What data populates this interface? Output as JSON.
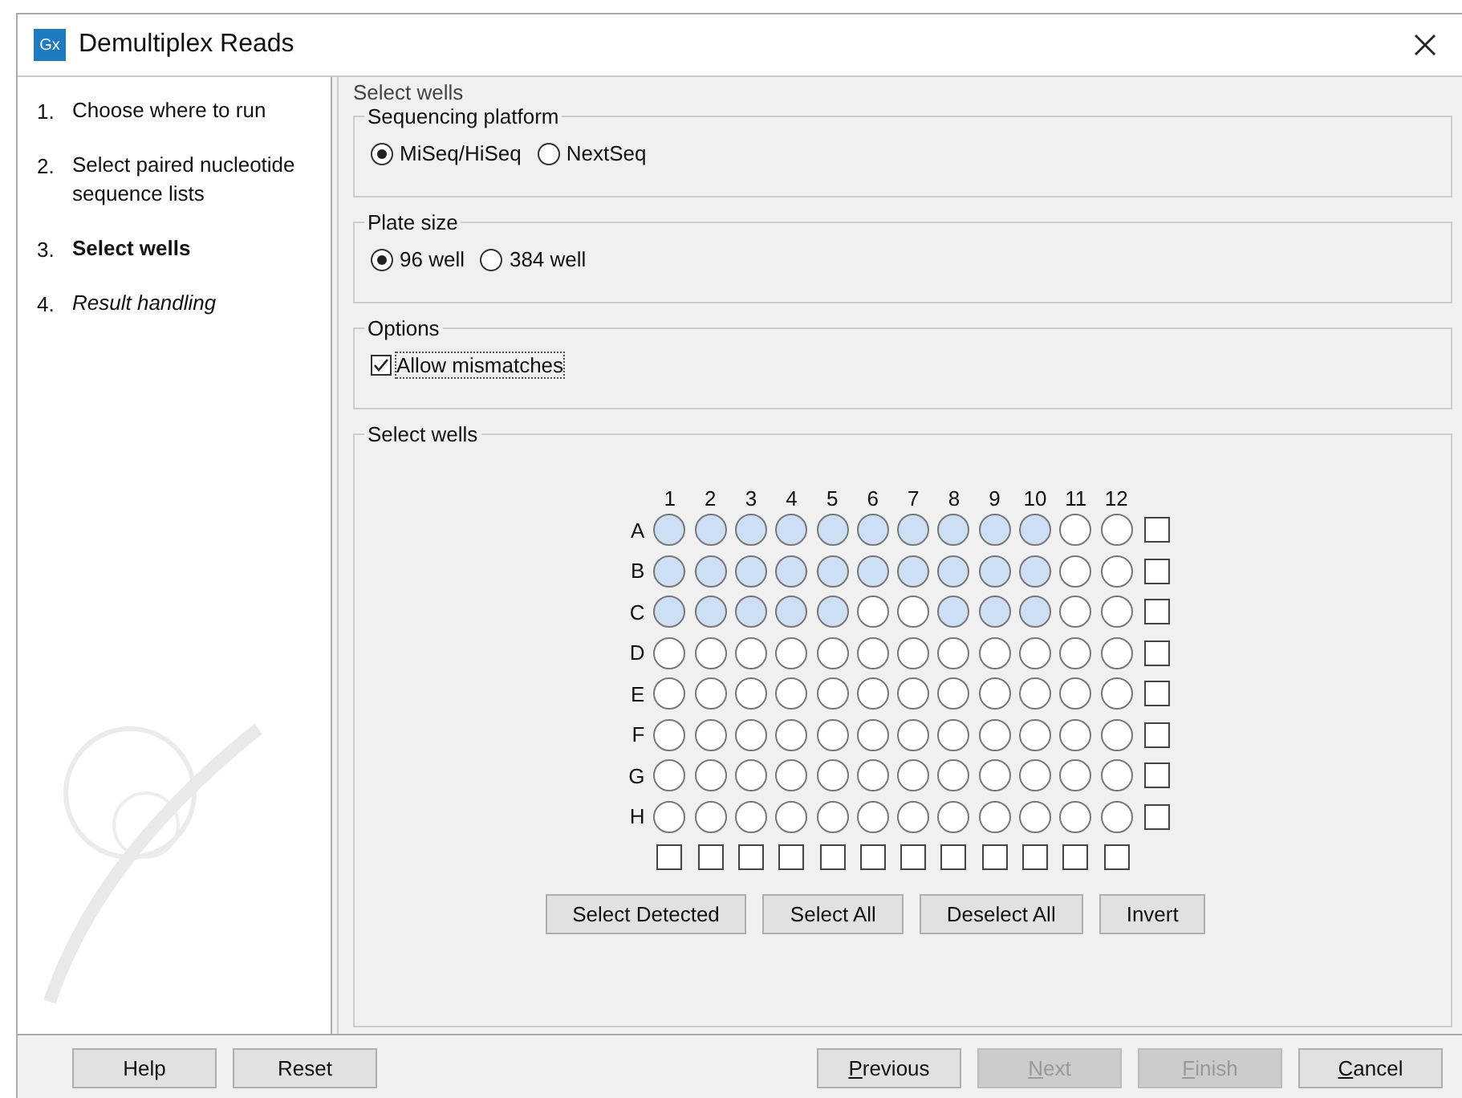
{
  "window": {
    "title": "Demultiplex Reads",
    "app_icon_text": "Gx"
  },
  "steps": [
    {
      "number": "1.",
      "label": "Choose where to run",
      "current": false,
      "pending": false
    },
    {
      "number": "2.",
      "label": "Select paired nucleotide sequence lists",
      "current": false,
      "pending": false
    },
    {
      "number": "3.",
      "label": "Select wells",
      "current": true,
      "pending": false
    },
    {
      "number": "4.",
      "label": "Result handling",
      "current": false,
      "pending": true
    }
  ],
  "page_title": "Select wells",
  "sequencing_platform": {
    "legend": "Sequencing platform",
    "options": [
      {
        "label": "MiSeq/HiSeq",
        "selected": true
      },
      {
        "label": "NextSeq",
        "selected": false
      }
    ]
  },
  "plate_size": {
    "legend": "Plate size",
    "options": [
      {
        "label": "96 well",
        "selected": true
      },
      {
        "label": "384 well",
        "selected": false
      }
    ]
  },
  "options": {
    "legend": "Options",
    "allow_mismatches": {
      "label": "Allow mismatches",
      "checked": true
    }
  },
  "select_wells": {
    "legend": "Select wells",
    "columns": [
      {
        "label": "1",
        "checked": false
      },
      {
        "label": "2",
        "checked": false
      },
      {
        "label": "3",
        "checked": false
      },
      {
        "label": "4",
        "checked": false
      },
      {
        "label": "5",
        "checked": false
      },
      {
        "label": "6",
        "checked": false
      },
      {
        "label": "7",
        "checked": false
      },
      {
        "label": "8",
        "checked": false
      },
      {
        "label": "9",
        "checked": false
      },
      {
        "label": "10",
        "checked": false
      },
      {
        "label": "11",
        "checked": false
      },
      {
        "label": "12",
        "checked": false
      }
    ],
    "rows": [
      {
        "label": "A",
        "checked": false,
        "wells": [
          true,
          true,
          true,
          true,
          true,
          true,
          true,
          true,
          true,
          true,
          false,
          false
        ]
      },
      {
        "label": "B",
        "checked": false,
        "wells": [
          true,
          true,
          true,
          true,
          true,
          true,
          true,
          true,
          true,
          true,
          false,
          false
        ]
      },
      {
        "label": "C",
        "checked": false,
        "wells": [
          true,
          true,
          true,
          true,
          true,
          false,
          false,
          true,
          true,
          true,
          false,
          false
        ]
      },
      {
        "label": "D",
        "checked": false,
        "wells": [
          false,
          false,
          false,
          false,
          false,
          false,
          false,
          false,
          false,
          false,
          false,
          false
        ]
      },
      {
        "label": "E",
        "checked": false,
        "wells": [
          false,
          false,
          false,
          false,
          false,
          false,
          false,
          false,
          false,
          false,
          false,
          false
        ]
      },
      {
        "label": "F",
        "checked": false,
        "wells": [
          false,
          false,
          false,
          false,
          false,
          false,
          false,
          false,
          false,
          false,
          false,
          false
        ]
      },
      {
        "label": "G",
        "checked": false,
        "wells": [
          false,
          false,
          false,
          false,
          false,
          false,
          false,
          false,
          false,
          false,
          false,
          false
        ]
      },
      {
        "label": "H",
        "checked": false,
        "wells": [
          false,
          false,
          false,
          false,
          false,
          false,
          false,
          false,
          false,
          false,
          false,
          false
        ]
      }
    ],
    "buttons": [
      "Select Detected",
      "Select All",
      "Deselect All",
      "Invert"
    ]
  },
  "footer_left": [
    {
      "rest": "Help",
      "disabled": false
    },
    {
      "rest": "Reset",
      "disabled": false
    }
  ],
  "footer_right": [
    {
      "mnemonic": "P",
      "rest": "revious",
      "disabled": false
    },
    {
      "mnemonic": "N",
      "rest": "ext",
      "disabled": true
    },
    {
      "mnemonic": "F",
      "rest": "inish",
      "disabled": true
    },
    {
      "mnemonic": "C",
      "rest": "ancel",
      "disabled": false
    }
  ]
}
